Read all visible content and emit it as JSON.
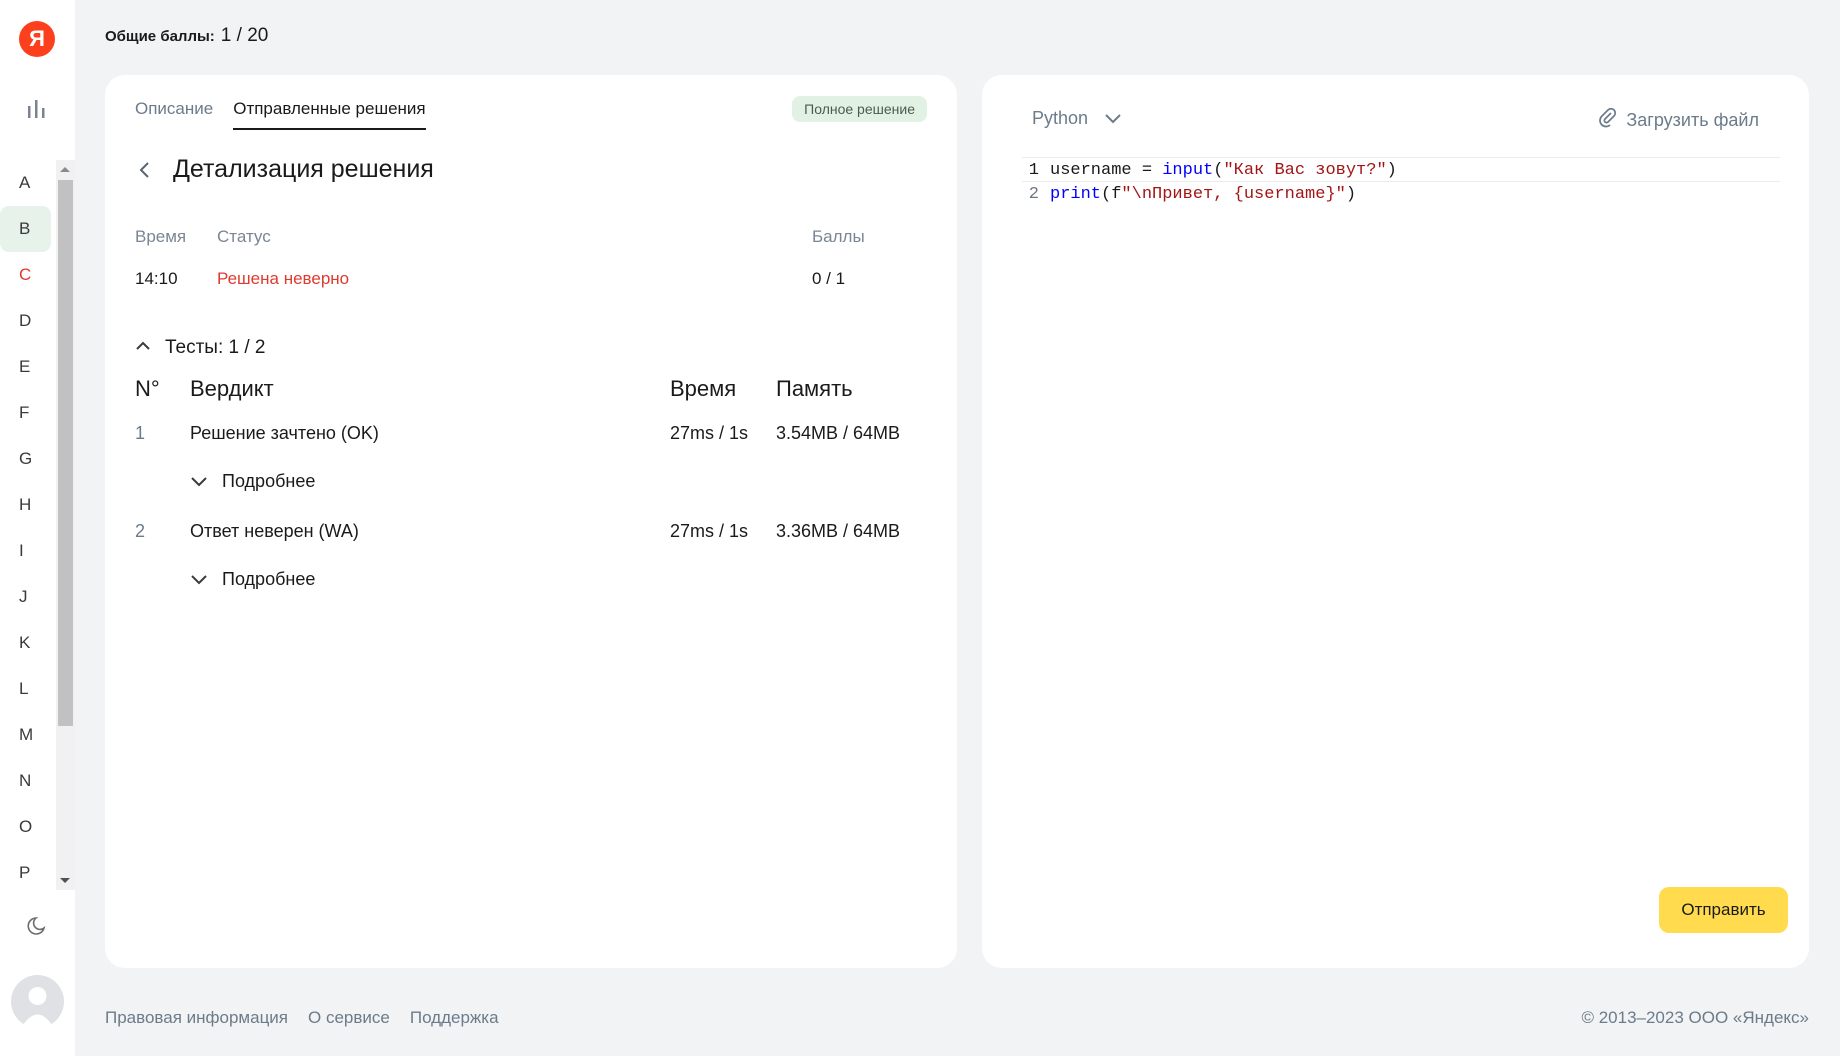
{
  "app": {
    "logo_text": "Я",
    "brand_color": "#fc3f1d"
  },
  "header": {
    "total_label": "Общие баллы:",
    "total_value": "1 / 20"
  },
  "sidebar": {
    "letters": [
      "A",
      "B",
      "C",
      "D",
      "E",
      "F",
      "G",
      "H",
      "I",
      "J",
      "K",
      "L",
      "M",
      "N",
      "O",
      "P"
    ],
    "active_letter": "B",
    "wrong_letter": "C"
  },
  "left_panel": {
    "tabs": [
      {
        "label": "Описание",
        "active": false
      },
      {
        "label": "Отправленные решения",
        "active": true
      }
    ],
    "badge": "Полное решение",
    "title": "Детализация решения",
    "meta": {
      "time_label": "Время",
      "status_label": "Статус",
      "score_label": "Баллы",
      "time_value": "14:10",
      "status_value": "Решена неверно",
      "score_value": "0 / 1"
    },
    "tests": {
      "label": "Тесты:",
      "value": "1 / 2",
      "headers": {
        "num": "N°",
        "verdict": "Вердикт",
        "time": "Время",
        "memory": "Память"
      },
      "rows": [
        {
          "num": "1",
          "verdict": "Решение зачтено (OK)",
          "time": "27ms / 1s",
          "memory": "3.54MB / 64MB",
          "more": "Подробнее"
        },
        {
          "num": "2",
          "verdict": "Ответ неверен (WA)",
          "time": "27ms / 1s",
          "memory": "3.36MB / 64MB",
          "more": "Подробнее"
        }
      ]
    }
  },
  "right_panel": {
    "language": "Python",
    "upload_label": "Загрузить файл",
    "code": [
      {
        "n": "1",
        "tokens": [
          {
            "t": "username = ",
            "c": "plain"
          },
          {
            "t": "input",
            "c": "fn"
          },
          {
            "t": "(",
            "c": "plain"
          },
          {
            "t": "\"Как Вас зовут?\"",
            "c": "str"
          },
          {
            "t": ")",
            "c": "plain"
          }
        ]
      },
      {
        "n": "2",
        "tokens": [
          {
            "t": "print",
            "c": "fn"
          },
          {
            "t": "(f",
            "c": "plain"
          },
          {
            "t": "\"\\nПривет, {username}\"",
            "c": "str"
          },
          {
            "t": ")",
            "c": "plain"
          }
        ]
      }
    ],
    "submit_label": "Отправить"
  },
  "footer": {
    "links": [
      "Правовая информация",
      "О сервисе",
      "Поддержка"
    ],
    "copyright": "© 2013–2023 ООО «Яндекс»"
  },
  "colors": {
    "accent_button": "#ffdb4d",
    "error": "#e03a2f",
    "badge_bg": "#e1f2e5"
  }
}
